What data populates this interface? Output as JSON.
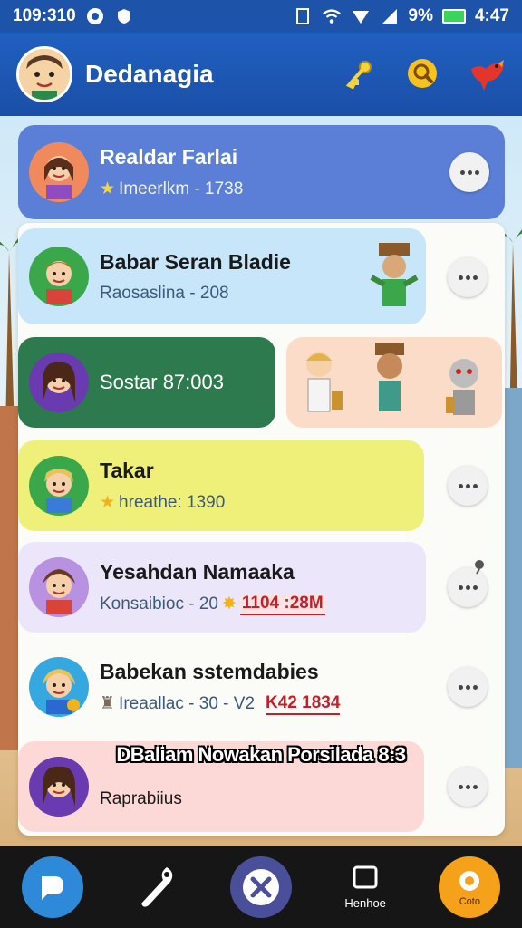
{
  "status_bar": {
    "time_left": "109:310",
    "battery_percent": "9%",
    "time_right": "4:47",
    "icons": [
      "camera-icon",
      "shield-icon",
      "sim-icon",
      "wifi-icon",
      "signal-icon",
      "cell-icon",
      "battery-icon"
    ]
  },
  "app_bar": {
    "title": "Dedanagia",
    "actions": [
      "key-icon",
      "search-icon",
      "bird-icon"
    ]
  },
  "rows": [
    {
      "name": "Realdar Farlai",
      "sub": "Imeerlkm - 1738",
      "bg": "#5b7fd6"
    },
    {
      "name": "Babar Seran Bladie",
      "sub": "Raosaslina - 208",
      "bg": "#c7e6fa"
    },
    {
      "name": "Sostar 87:003",
      "bg": "#2d7a4e"
    },
    {
      "name": "Takar",
      "sub": "hreathe: 1390",
      "bg": "#eef07a"
    },
    {
      "name": "Yesahdan Namaaka",
      "sub": "Konsaibioc - 20",
      "tag": "1104 :28M",
      "bg": "#ece6fb"
    },
    {
      "name": "Babekan sstemdabies",
      "sub": "Ireaallac - 30 - V2",
      "tag": "K42 1834",
      "bg": "#fbfbf8"
    },
    {
      "name": "",
      "sub": "Raprabiius",
      "bg": "#fcd9d6"
    }
  ],
  "caption": "DBaliam Nowakan Porsilada 8:3",
  "bottom_nav": {
    "items": [
      {
        "icon": "chat-icon"
      },
      {
        "icon": "wrench-icon"
      },
      {
        "icon": "close-icon"
      },
      {
        "icon": "square-icon",
        "label": "Henhoe"
      },
      {
        "icon": "egg-icon",
        "label": "Coto"
      }
    ]
  },
  "colors": {
    "status_bar": "#1d53a8",
    "app_bar": "#1a4fa7",
    "accent_orange": "#f5a11a",
    "nav_bg": "#161616"
  }
}
